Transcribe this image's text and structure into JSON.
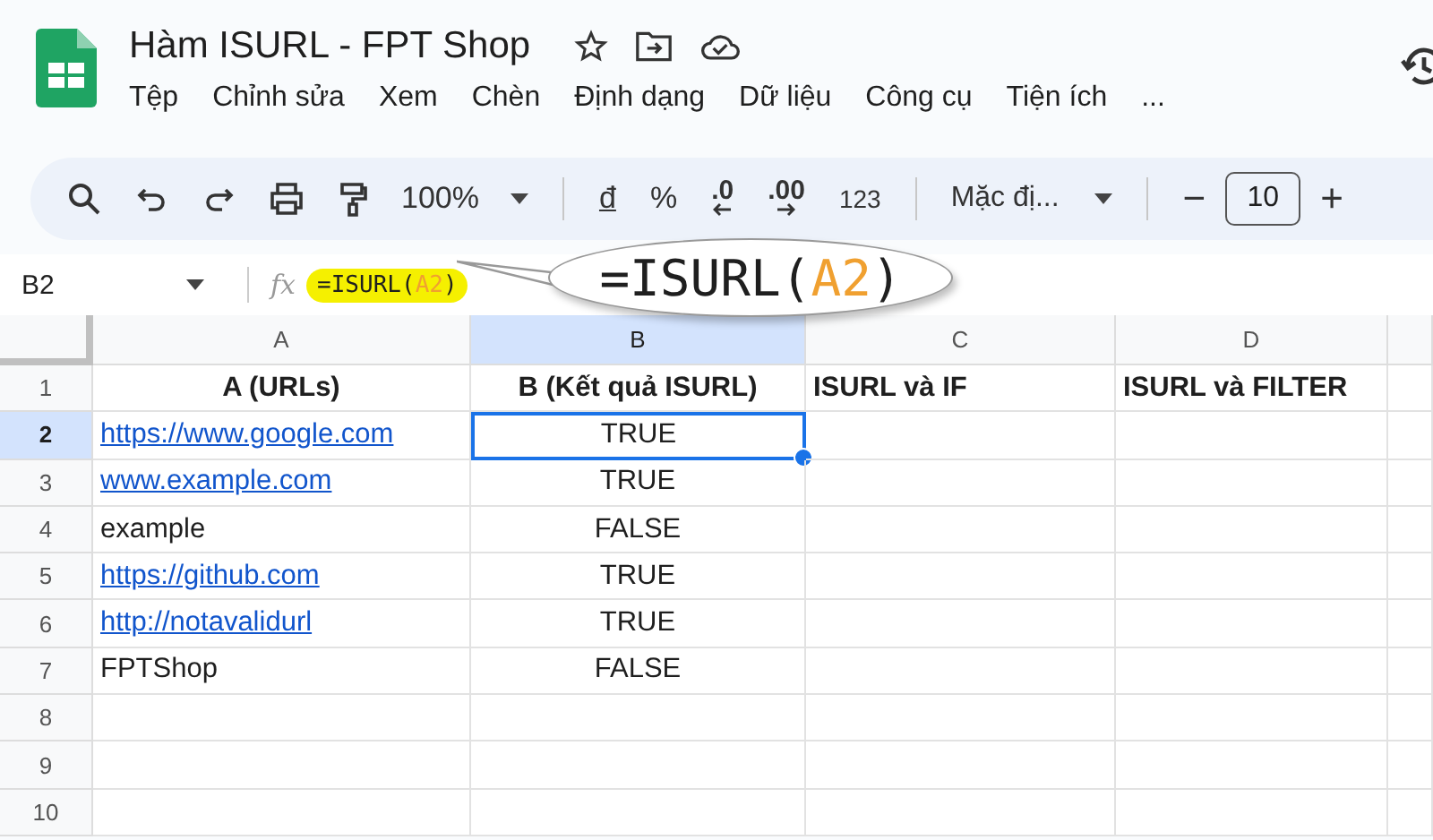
{
  "document": {
    "title": "Hàm ISURL - FPT Shop"
  },
  "menu": [
    "Tệp",
    "Chỉnh sửa",
    "Xem",
    "Chèn",
    "Định dạng",
    "Dữ liệu",
    "Công cụ",
    "Tiện ích",
    "..."
  ],
  "toolbar": {
    "zoom": "100%",
    "currency": "đ",
    "percent": "%",
    "decrease_decimals": ".0",
    "increase_decimals": ".00",
    "number_format": "123",
    "font": "Mặc đị...",
    "minus": "−",
    "font_size": "10",
    "plus": "+"
  },
  "formula_bar": {
    "cell_ref": "B2",
    "fx": "fx",
    "formula": {
      "prefix": "=ISURL(",
      "ref": "A2",
      "suffix": ")"
    }
  },
  "callout": {
    "prefix": "=ISURL(",
    "ref": "A2",
    "suffix": ")"
  },
  "columns": [
    {
      "label": "A",
      "selected": false
    },
    {
      "label": "B",
      "selected": true
    },
    {
      "label": "C",
      "selected": false
    },
    {
      "label": "D",
      "selected": false
    }
  ],
  "rows": [
    {
      "number": "1",
      "selected": false,
      "cells": [
        {
          "text": "A (URLs)",
          "kind": "header",
          "selected": false
        },
        {
          "text": "B (Kết quả ISURL)",
          "kind": "header",
          "selected": false
        },
        {
          "text": "ISURL và IF",
          "kind": "header_left",
          "selected": false
        },
        {
          "text": "ISURL và FILTER",
          "kind": "header_left",
          "selected": false
        }
      ]
    },
    {
      "number": "2",
      "selected": true,
      "cells": [
        {
          "text": "https://www.google.com",
          "kind": "link",
          "selected": false
        },
        {
          "text": "TRUE",
          "kind": "center",
          "selected": true
        }
      ]
    },
    {
      "number": "3",
      "selected": false,
      "cells": [
        {
          "text": "www.example.com",
          "kind": "link",
          "selected": false
        },
        {
          "text": "TRUE",
          "kind": "center",
          "selected": false
        }
      ]
    },
    {
      "number": "4",
      "selected": false,
      "cells": [
        {
          "text": "example",
          "kind": "plain",
          "selected": false
        },
        {
          "text": "FALSE",
          "kind": "center",
          "selected": false
        }
      ]
    },
    {
      "number": "5",
      "selected": false,
      "cells": [
        {
          "text": "https://github.com",
          "kind": "link",
          "selected": false
        },
        {
          "text": "TRUE",
          "kind": "center",
          "selected": false
        }
      ]
    },
    {
      "number": "6",
      "selected": false,
      "cells": [
        {
          "text": "http://notavalidurl",
          "kind": "link",
          "selected": false
        },
        {
          "text": "TRUE",
          "kind": "center",
          "selected": false
        }
      ]
    },
    {
      "number": "7",
      "selected": false,
      "cells": [
        {
          "text": "FPTShop",
          "kind": "plain",
          "selected": false
        },
        {
          "text": "FALSE",
          "kind": "center",
          "selected": false
        }
      ]
    },
    {
      "number": "8",
      "selected": false,
      "cells": []
    },
    {
      "number": "9",
      "selected": false,
      "cells": []
    },
    {
      "number": "10",
      "selected": false,
      "cells": []
    }
  ]
}
